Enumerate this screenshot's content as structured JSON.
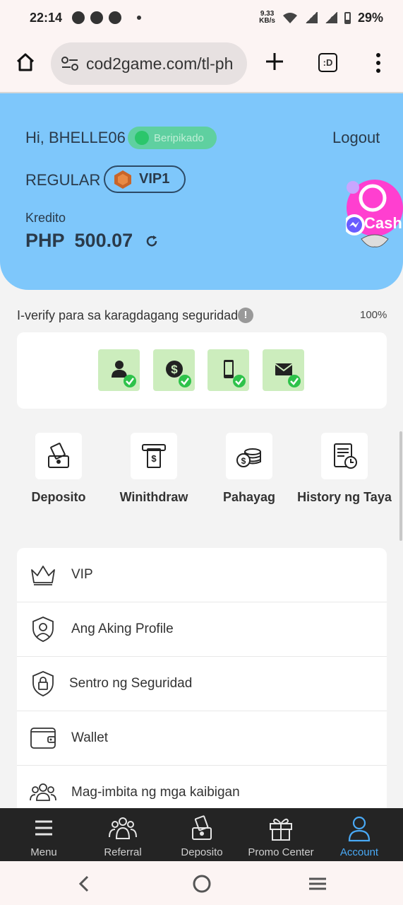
{
  "status_bar": {
    "time": "22:14",
    "speed": "9.33",
    "speed_unit": "KB/s",
    "battery": "29%"
  },
  "browser": {
    "url": "cod2game.com/tl-ph",
    "tabs_label": ":D"
  },
  "header": {
    "greeting": "Hi, BHELLE06",
    "verified_label": "Beripikado",
    "logout_label": "Logout",
    "tier": "REGULAR",
    "vip_label": "VIP1",
    "credit_label": "Kredito",
    "currency": "PHP",
    "balance": "500.07"
  },
  "floating": {
    "gcash_label": "Cash"
  },
  "verify": {
    "text": "I-verify para sa karagdagang seguridad.",
    "info": "!",
    "percent": "100%"
  },
  "quick_actions": [
    {
      "label": "Deposito"
    },
    {
      "label": "Winithdraw"
    },
    {
      "label": "Pahayag"
    },
    {
      "label": "History ng Taya"
    }
  ],
  "menu": [
    {
      "label": "VIP"
    },
    {
      "label": "Ang Aking Profile"
    },
    {
      "label": "Sentro ng Seguridad"
    },
    {
      "label": "Wallet"
    },
    {
      "label": "Mag-imbita ng mga kaibigan"
    }
  ],
  "bottom_nav": [
    {
      "label": "Menu"
    },
    {
      "label": "Referral"
    },
    {
      "label": "Deposito"
    },
    {
      "label": "Promo Center"
    },
    {
      "label": "Account"
    }
  ],
  "colors": {
    "header_bg": "#7ec7fb",
    "verified_bg": "#5fd0a0",
    "active_nav": "#49a9f5",
    "verify_box": "#ccedbd"
  }
}
